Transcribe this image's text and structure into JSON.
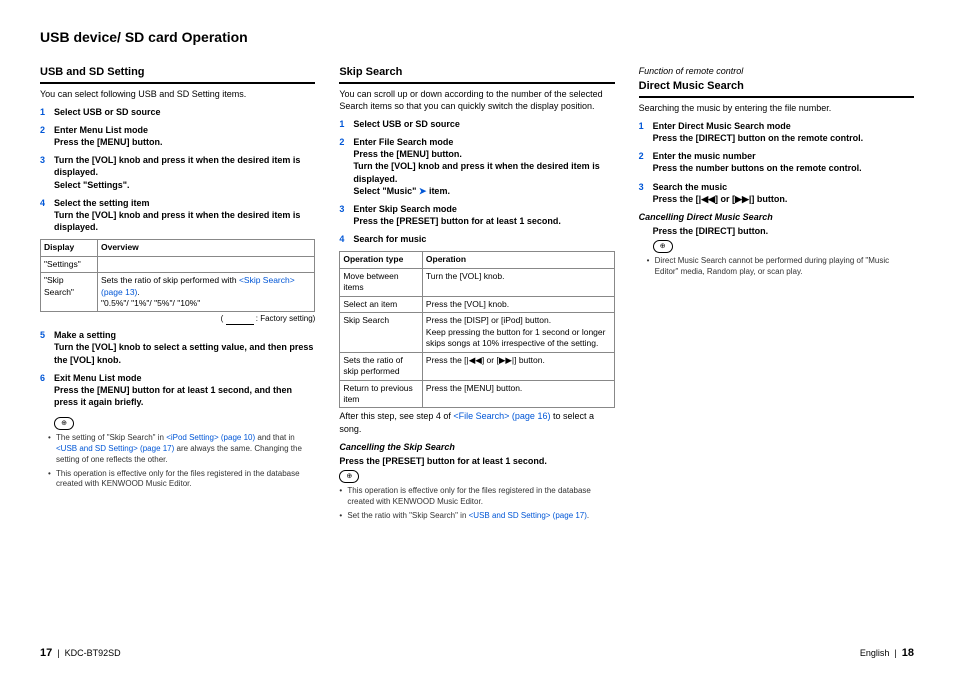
{
  "page_title": "USB device/ SD card Operation",
  "footer": {
    "left_pn": "17",
    "left_model": "KDC-BT92SD",
    "right_lang": "English",
    "right_pn": "18"
  },
  "col1": {
    "heading": "USB and SD Setting",
    "intro": "You can select following USB and SD Setting items.",
    "steps": [
      {
        "title": "Select USB or SD source",
        "body": ""
      },
      {
        "title": "Enter Menu List mode",
        "body": "Press the [MENU] button."
      },
      {
        "title": "",
        "body": "Turn the [VOL] knob and press it when the desired item is displayed.\nSelect \"Settings\"."
      },
      {
        "title": "Select the setting item",
        "body": "Turn the [VOL] knob and press it when the desired item is displayed."
      }
    ],
    "table": {
      "headers": [
        "Display",
        "Overview"
      ],
      "rows": [
        {
          "c1": "\"Settings\"",
          "c2": ""
        },
        {
          "c1": "\"Skip Search\"",
          "c2_pre": "Sets the ratio of skip performed with ",
          "c2_link": "<Skip Search> (page 13)",
          "c2_post": ".",
          "c2_line2": "\"0.5%\"/ \"1%\"/ \"5%\"/ \"10%\""
        }
      ]
    },
    "factory": ": Factory setting)",
    "steps2": [
      {
        "n": "5",
        "title": "Make a setting",
        "body": "Turn the [VOL] knob to select a setting value, and then press the [VOL] knob."
      },
      {
        "n": "6",
        "title": "Exit Menu List mode",
        "body": "Press the [MENU] button for at least 1 second, and then press it again briefly."
      }
    ],
    "notes": [
      {
        "pre": "The setting of \"Skip Search\" in ",
        "l1": "<iPod Setting> (page 10)",
        "mid": " and that in ",
        "l2": "<USB and SD Setting> (page 17)",
        "post": " are always the same. Changing the setting of one reflects the other."
      },
      {
        "text": "This operation is effective only for the files registered in the database created with KENWOOD Music Editor."
      }
    ]
  },
  "col2": {
    "heading": "Skip Search",
    "intro": "You can scroll up or down according to the number of the selected Search items so that you can quickly switch the display position.",
    "steps": [
      {
        "title": "Select USB or SD source",
        "body": ""
      },
      {
        "title": "Enter File Search mode",
        "body": "Press the [MENU] button.\nTurn the [VOL] knob and press it when the desired item is displayed.\nSelect \"Music\" ",
        "arrow": true,
        "body2": " item."
      },
      {
        "title": "Enter Skip Search mode",
        "body": "Press the [PRESET] button for at least 1 second."
      },
      {
        "title": "Search for music",
        "body": ""
      }
    ],
    "table": {
      "headers": [
        "Operation type",
        "Operation"
      ],
      "rows": [
        {
          "c1": "Move between items",
          "c2": "Turn the [VOL] knob."
        },
        {
          "c1": "Select an item",
          "c2": "Press the [VOL] knob."
        },
        {
          "c1": "Skip Search",
          "c2": "Press the [DISP] or [iPod] button.\nKeep pressing the button for 1 second or longer skips songs at 10% irrespective of the setting."
        },
        {
          "c1": "Sets the ratio of skip performed",
          "c2": "Press the [|◀◀] or [▶▶|] button."
        },
        {
          "c1": "Return to previous item",
          "c2": "Press the [MENU] button."
        }
      ]
    },
    "after_pre": "After this step, see step 4 of ",
    "after_link": "<File Search> (page 16)",
    "after_post": " to select a song.",
    "cancel_head": "Cancelling the Skip Search",
    "cancel_body": "Press the [PRESET] button for at least 1 second.",
    "notes": [
      {
        "text": "This operation is effective only for the files registered in the database created with KENWOOD Music Editor."
      },
      {
        "pre": "Set the ratio with \"Skip Search\" in ",
        "l1": "<USB and SD Setting> (page 17)",
        "post": "."
      }
    ]
  },
  "col3": {
    "func": "Function of remote control",
    "heading": "Direct Music Search",
    "intro": "Searching the music by entering the file number.",
    "steps": [
      {
        "title": "Enter Direct Music Search mode",
        "body": "Press the [DIRECT] button on the remote control."
      },
      {
        "title": "Enter the music number",
        "body": "Press the number buttons on the remote control."
      },
      {
        "title": "Search the music",
        "body": "Press the [|◀◀] or [▶▶|] button."
      }
    ],
    "cancel_head": "Cancelling Direct Music Search",
    "cancel_body": "Press the [DIRECT] button.",
    "notes": [
      {
        "text": "Direct Music Search cannot be performed during playing of \"Music Editor\" media, Random play, or scan play."
      }
    ]
  }
}
